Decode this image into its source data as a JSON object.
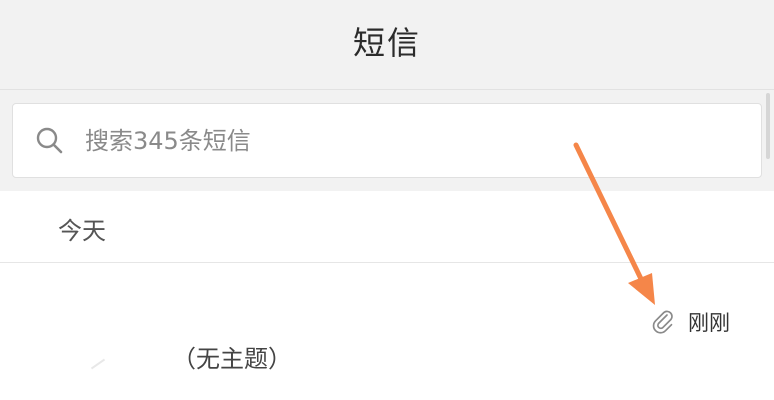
{
  "header": {
    "title": "短信"
  },
  "search": {
    "placeholder": "搜索345条短信",
    "value": ""
  },
  "section": {
    "label": "今天"
  },
  "message": {
    "subject": "（无主题）",
    "time": "刚刚",
    "has_attachment": true
  },
  "colors": {
    "header_bg": "#f2f2f2",
    "annotation_arrow": "#f58649"
  },
  "icons": {
    "search": "search-icon",
    "attachment": "paperclip-icon"
  }
}
